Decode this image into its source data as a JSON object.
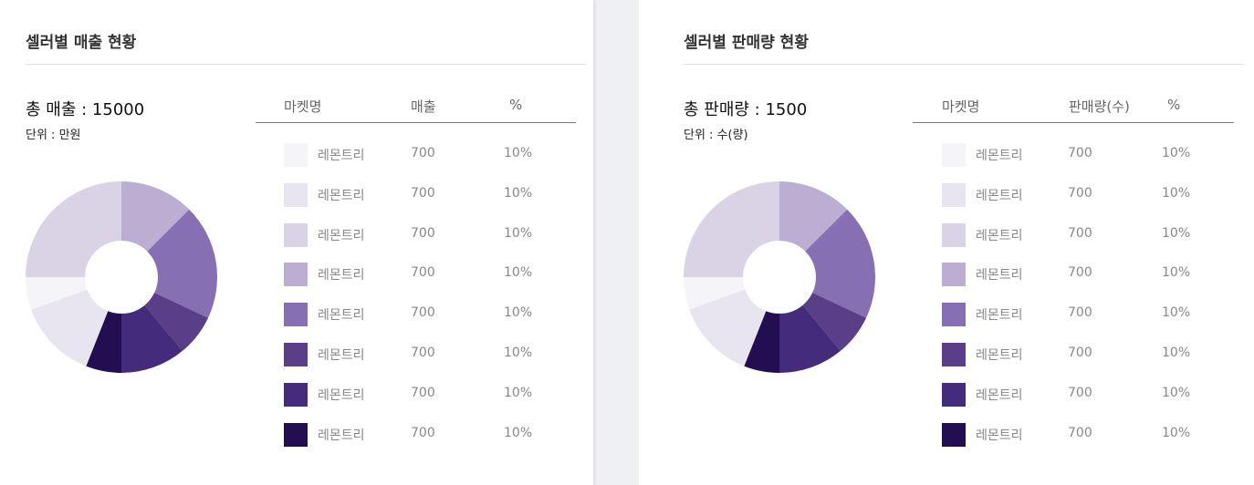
{
  "colors": [
    "#f5f4f8",
    "#e8e5f1",
    "#dad3e6",
    "#bcaed2",
    "#866fb2",
    "#5a3f88",
    "#442b7b",
    "#230e52"
  ],
  "panels": [
    {
      "title": "셀러별  매출 현황",
      "total": "총 매출 : 15000",
      "unit": "단위 : 만원",
      "headers": [
        "마켓명",
        "매출",
        "%"
      ],
      "rows": [
        {
          "name": "레몬트리",
          "value": "700",
          "pct": "10%"
        },
        {
          "name": "레몬트리",
          "value": "700",
          "pct": "10%"
        },
        {
          "name": "레몬트리",
          "value": "700",
          "pct": "10%"
        },
        {
          "name": "레몬트리",
          "value": "700",
          "pct": "10%"
        },
        {
          "name": "레몬트리",
          "value": "700",
          "pct": "10%"
        },
        {
          "name": "레몬트리",
          "value": "700",
          "pct": "10%"
        },
        {
          "name": "레몬트리",
          "value": "700",
          "pct": "10%"
        },
        {
          "name": "레몬트리",
          "value": "700",
          "pct": "10%"
        }
      ]
    },
    {
      "title": "셀러별  판매량 현황",
      "total": "총 판매량 : 1500",
      "unit": "단위 : 수(량)",
      "headers": [
        "마켓명",
        "판매량(수)",
        "%"
      ],
      "rows": [
        {
          "name": "레몬트리",
          "value": "700",
          "pct": "10%"
        },
        {
          "name": "레몬트리",
          "value": "700",
          "pct": "10%"
        },
        {
          "name": "레몬트리",
          "value": "700",
          "pct": "10%"
        },
        {
          "name": "레몬트리",
          "value": "700",
          "pct": "10%"
        },
        {
          "name": "레몬트리",
          "value": "700",
          "pct": "10%"
        },
        {
          "name": "레몬트리",
          "value": "700",
          "pct": "10%"
        },
        {
          "name": "레몬트리",
          "value": "700",
          "pct": "10%"
        },
        {
          "name": "레몬트리",
          "value": "700",
          "pct": "10%"
        }
      ]
    }
  ],
  "chart_data": [
    {
      "type": "pie",
      "slices": [
        {
          "value": 12.5,
          "color": "#bcaed2"
        },
        {
          "value": 19.5,
          "color": "#866fb2"
        },
        {
          "value": 7,
          "color": "#5a3f88"
        },
        {
          "value": 11,
          "color": "#442b7b"
        },
        {
          "value": 6,
          "color": "#230e52"
        },
        {
          "value": 13.5,
          "color": "#e8e5f1"
        },
        {
          "value": 5.5,
          "color": "#f5f4f8"
        },
        {
          "value": 25,
          "color": "#dad3e6"
        }
      ]
    },
    {
      "type": "pie",
      "slices": [
        {
          "value": 12.5,
          "color": "#bcaed2"
        },
        {
          "value": 19.5,
          "color": "#866fb2"
        },
        {
          "value": 7,
          "color": "#5a3f88"
        },
        {
          "value": 11,
          "color": "#442b7b"
        },
        {
          "value": 6,
          "color": "#230e52"
        },
        {
          "value": 13.5,
          "color": "#e8e5f1"
        },
        {
          "value": 5.5,
          "color": "#f5f4f8"
        },
        {
          "value": 25,
          "color": "#dad3e6"
        }
      ]
    }
  ]
}
